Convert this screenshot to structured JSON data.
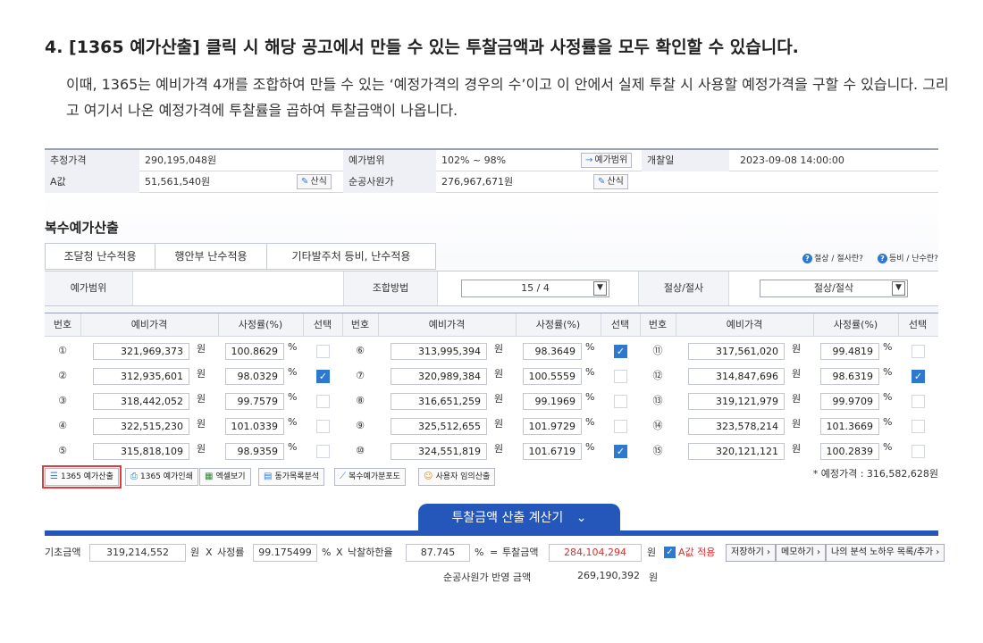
{
  "heading": "4. [1365 예가산출] 클릭 시 해당 공고에서 만들 수 있는 투찰금액과 사정률을 모두 확인할 수 있습니다.",
  "desc": "이때, 1365는 예비가격 4개를 조합하여 만들 수 있는 ‘예정가격의 경우의 수’이고 이 안에서 실제 투찰 시 사용할 예정가격을 구할 수 있습니다. 그리고 여기서 나온 예정가격에 투찰률을 곱하여 투찰금액이 나옵니다.",
  "info": {
    "est_price_label": "추정가격",
    "est_price": "290,195,048원",
    "price_range_label": "예가범위",
    "price_range": "102% ~ 98%",
    "price_range_btn": "예가범위",
    "open_date_label": "개찰일",
    "open_date": "2023-09-08 14:00:00",
    "a_label": "A값",
    "a_value": "51,561,540원",
    "calc_btn": "산식",
    "net_cost_label": "순공사원가",
    "net_cost": "276,967,671원",
    "calc_btn2": "산식"
  },
  "section_title": "복수예가산출",
  "tabs": [
    "조달청 난수적용",
    "행안부 난수적용",
    "기타발주처 등비, 난수적용"
  ],
  "help": {
    "cut_label": "절상 / 절사란?",
    "equal_label": "등비 / 난수란?"
  },
  "options": {
    "range_label": "예가범위",
    "combo_label": "조합방법",
    "combo_value": "15 / 4",
    "round_label": "절상/절사",
    "round_value": "절상/절삭"
  },
  "grid": {
    "headers": {
      "no": "번호",
      "price": "예비가격",
      "rate": "사정률(%)",
      "select": "선택"
    },
    "unit_won": "원",
    "unit_pct": "%",
    "cols": [
      [
        {
          "no": "①",
          "price": "321,969,373",
          "rate": "100.8629",
          "checked": false
        },
        {
          "no": "②",
          "price": "312,935,601",
          "rate": "98.0329",
          "checked": true
        },
        {
          "no": "③",
          "price": "318,442,052",
          "rate": "99.7579",
          "checked": false
        },
        {
          "no": "④",
          "price": "322,515,230",
          "rate": "101.0339",
          "checked": false
        },
        {
          "no": "⑤",
          "price": "315,818,109",
          "rate": "98.9359",
          "checked": false
        }
      ],
      [
        {
          "no": "⑥",
          "price": "313,995,394",
          "rate": "98.3649",
          "checked": true
        },
        {
          "no": "⑦",
          "price": "320,989,384",
          "rate": "100.5559",
          "checked": false
        },
        {
          "no": "⑧",
          "price": "316,651,259",
          "rate": "99.1969",
          "checked": false
        },
        {
          "no": "⑨",
          "price": "325,512,655",
          "rate": "101.9729",
          "checked": false
        },
        {
          "no": "⑩",
          "price": "324,551,819",
          "rate": "101.6719",
          "checked": true
        }
      ],
      [
        {
          "no": "⑪",
          "price": "317,561,020",
          "rate": "99.4819",
          "checked": false
        },
        {
          "no": "⑫",
          "price": "314,847,696",
          "rate": "98.6319",
          "checked": true
        },
        {
          "no": "⑬",
          "price": "319,121,979",
          "rate": "99.9709",
          "checked": false
        },
        {
          "no": "⑭",
          "price": "323,578,214",
          "rate": "101.3669",
          "checked": false
        },
        {
          "no": "⑮",
          "price": "320,121,121",
          "rate": "100.2839",
          "checked": false
        }
      ]
    ]
  },
  "tools": [
    "1365 예가산출",
    "1365 예가인쇄",
    "엑셀보기",
    "동가목록분석",
    "복수예가분포도",
    "사용자 임의산출"
  ],
  "estimated_price": "* 예정가격 : 316,582,628원",
  "calc_button": "투찰금액 산출 계산기",
  "bottom": {
    "base_label": "기초금액",
    "base_value": "319,214,552",
    "won": "원",
    "x1": "X",
    "rate_label": "사정률",
    "rate_value": "99.175499",
    "pct": "%",
    "x2": "X",
    "lower_label": "낙찰하한율",
    "lower_value": "87.745",
    "pct2": "%",
    "eq": "=",
    "bid_label": "투찰금액",
    "bid_value": "284,104,294",
    "won2": "원",
    "a_apply": "A값 적용",
    "save": "저장하기",
    "memo": "메모하기",
    "myanalysis": "나의 분석 노하우 목록/추가"
  },
  "reflect": {
    "label": "순공사원가 반영 금액",
    "value": "269,190,392",
    "won": "원"
  }
}
